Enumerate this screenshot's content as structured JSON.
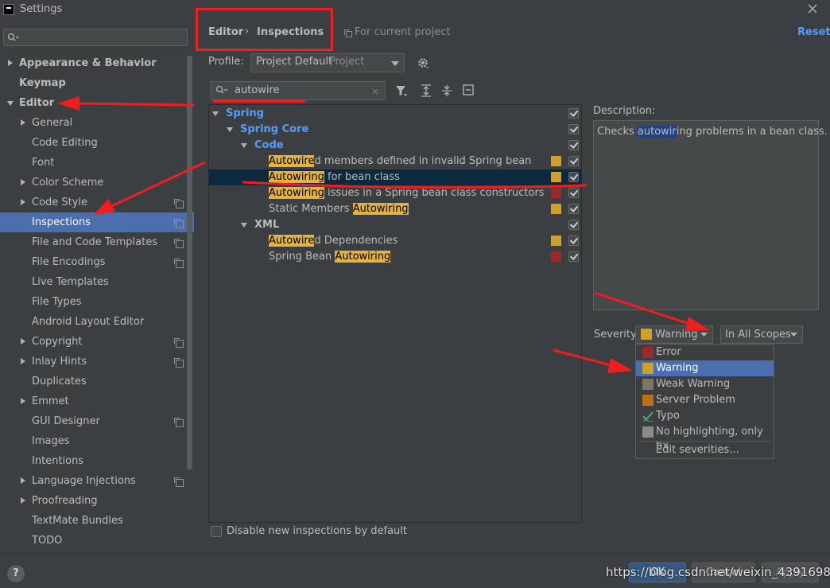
{
  "window": {
    "title": "Settings",
    "icon": "intellij-icon",
    "close_icon": "close-icon"
  },
  "sidebar": {
    "search_placeholder": "",
    "items": [
      {
        "label": "Appearance & Behavior",
        "bold": true,
        "expander": "collapsed"
      },
      {
        "label": "Keymap",
        "bold": true
      },
      {
        "label": "Editor",
        "bold": true,
        "expander": "expanded"
      },
      {
        "label": "General",
        "expander": "collapsed"
      },
      {
        "label": "Code Editing"
      },
      {
        "label": "Font"
      },
      {
        "label": "Color Scheme",
        "expander": "collapsed"
      },
      {
        "label": "Code Style",
        "expander": "collapsed",
        "project_icon": true
      },
      {
        "label": "Inspections",
        "selected": true,
        "project_icon": true
      },
      {
        "label": "File and Code Templates",
        "project_icon": true
      },
      {
        "label": "File Encodings",
        "project_icon": true
      },
      {
        "label": "Live Templates"
      },
      {
        "label": "File Types"
      },
      {
        "label": "Android Layout Editor"
      },
      {
        "label": "Copyright",
        "expander": "collapsed",
        "project_icon": true
      },
      {
        "label": "Inlay Hints",
        "expander": "collapsed",
        "project_icon": true
      },
      {
        "label": "Duplicates"
      },
      {
        "label": "Emmet",
        "expander": "collapsed"
      },
      {
        "label": "GUI Designer",
        "project_icon": true
      },
      {
        "label": "Images"
      },
      {
        "label": "Intentions"
      },
      {
        "label": "Language Injections",
        "expander": "collapsed",
        "project_icon": true
      },
      {
        "label": "Proofreading",
        "expander": "collapsed"
      },
      {
        "label": "TextMate Bundles"
      },
      {
        "label": "TODO"
      }
    ]
  },
  "header": {
    "breadcrumb": [
      "Editor",
      "Inspections"
    ],
    "separator": "›",
    "scope_note": "For current project",
    "reset_label": "Reset"
  },
  "profile": {
    "label": "Profile:",
    "value": "Project Default",
    "sub": "Project"
  },
  "filter": {
    "value": "autowire",
    "clear": "×"
  },
  "tree": {
    "rows": [
      {
        "kind": "group1",
        "label": "Spring"
      },
      {
        "kind": "group2",
        "label": "Spring Core"
      },
      {
        "kind": "group3",
        "label": "Code"
      },
      {
        "kind": "leaf",
        "pre": "",
        "hl": "Autowire",
        "post": "d members defined in invalid Spring bean",
        "severity_color": "#d1a029"
      },
      {
        "kind": "leaf",
        "pre": "",
        "hl": "Autowiring",
        "post": " for bean class",
        "severity_color": "#d1a029",
        "selected": true
      },
      {
        "kind": "leaf",
        "pre": "",
        "hl": "Autowiring",
        "post": " issues in a Spring bean class constructors",
        "severity_color": "#9b2b2b"
      },
      {
        "kind": "leaf",
        "pre": "Static Members ",
        "hl": "Autowiring",
        "post": "",
        "severity_color": "#d1a029"
      },
      {
        "kind": "group3",
        "label": "XML"
      },
      {
        "kind": "leaf",
        "pre": "",
        "hl": "Autowire",
        "post": "d Dependencies",
        "severity_color": "#d1a029"
      },
      {
        "kind": "leaf",
        "pre": "Spring Bean ",
        "hl": "Autowiring",
        "post": "",
        "severity_color": "#9b2b2b"
      }
    ]
  },
  "disable_new": {
    "label": "Disable new inspections by default"
  },
  "description": {
    "label": "Description:",
    "pre": "Checks ",
    "hl": "autowir",
    "post": "ing problems in a bean class."
  },
  "severity": {
    "label": "Severity:",
    "value": "Warning",
    "value_color": "#d1a029",
    "scope_value": "In All Scopes",
    "options": [
      {
        "label": "Error",
        "color": "#9b2b2b"
      },
      {
        "label": "Warning",
        "color": "#d1a029",
        "selected": true
      },
      {
        "label": "Weak Warning",
        "color": "#7f7564"
      },
      {
        "label": "Server Problem",
        "color": "#c06f14"
      },
      {
        "label": "Typo",
        "color": "typo-check-icon"
      },
      {
        "label": "No highlighting, only fix",
        "color": "#8a8a8a"
      }
    ],
    "edit_label": "Edit severities..."
  },
  "buttons": {
    "help": "?",
    "ok": "OK",
    "cancel": "Cancel",
    "apply": "Apply"
  },
  "watermark": "https://blog.csdn.net/weixin_43916982"
}
